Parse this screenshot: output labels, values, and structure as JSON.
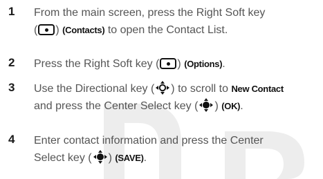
{
  "steps": [
    {
      "number": "1",
      "line1": "From the main screen, press the Right Soft key",
      "line2_open": "(",
      "line2_close": ")",
      "line2_tag": "(Contacts)",
      "line2_rest": " to open the Contact List."
    },
    {
      "number": "2",
      "pre": "Press the Right Soft key (",
      "post": ")",
      "tag": "(Options)",
      "end": "."
    },
    {
      "number": "3",
      "line1_pre": "Use the Directional key (",
      "line1_mid": ") to scroll to ",
      "line1_bold": "New Contact",
      "line2_pre": "and press the Center Select key (",
      "line2_post": ")",
      "line2_tag": "(OK)",
      "line2_end": "."
    },
    {
      "number": "4",
      "line1": "Enter contact information and press the Center",
      "line2_pre": "Select key (",
      "line2_post": ")",
      "line2_tag": "(SAVE)",
      "line2_end": "."
    }
  ],
  "icons": {
    "soft_key": "soft-key-icon",
    "directional_key": "directional-key-icon",
    "center_select_key": "center-select-key-icon"
  },
  "colors": {
    "text": "#555555",
    "number": "#1a1a1a",
    "watermark": "#ededed"
  }
}
